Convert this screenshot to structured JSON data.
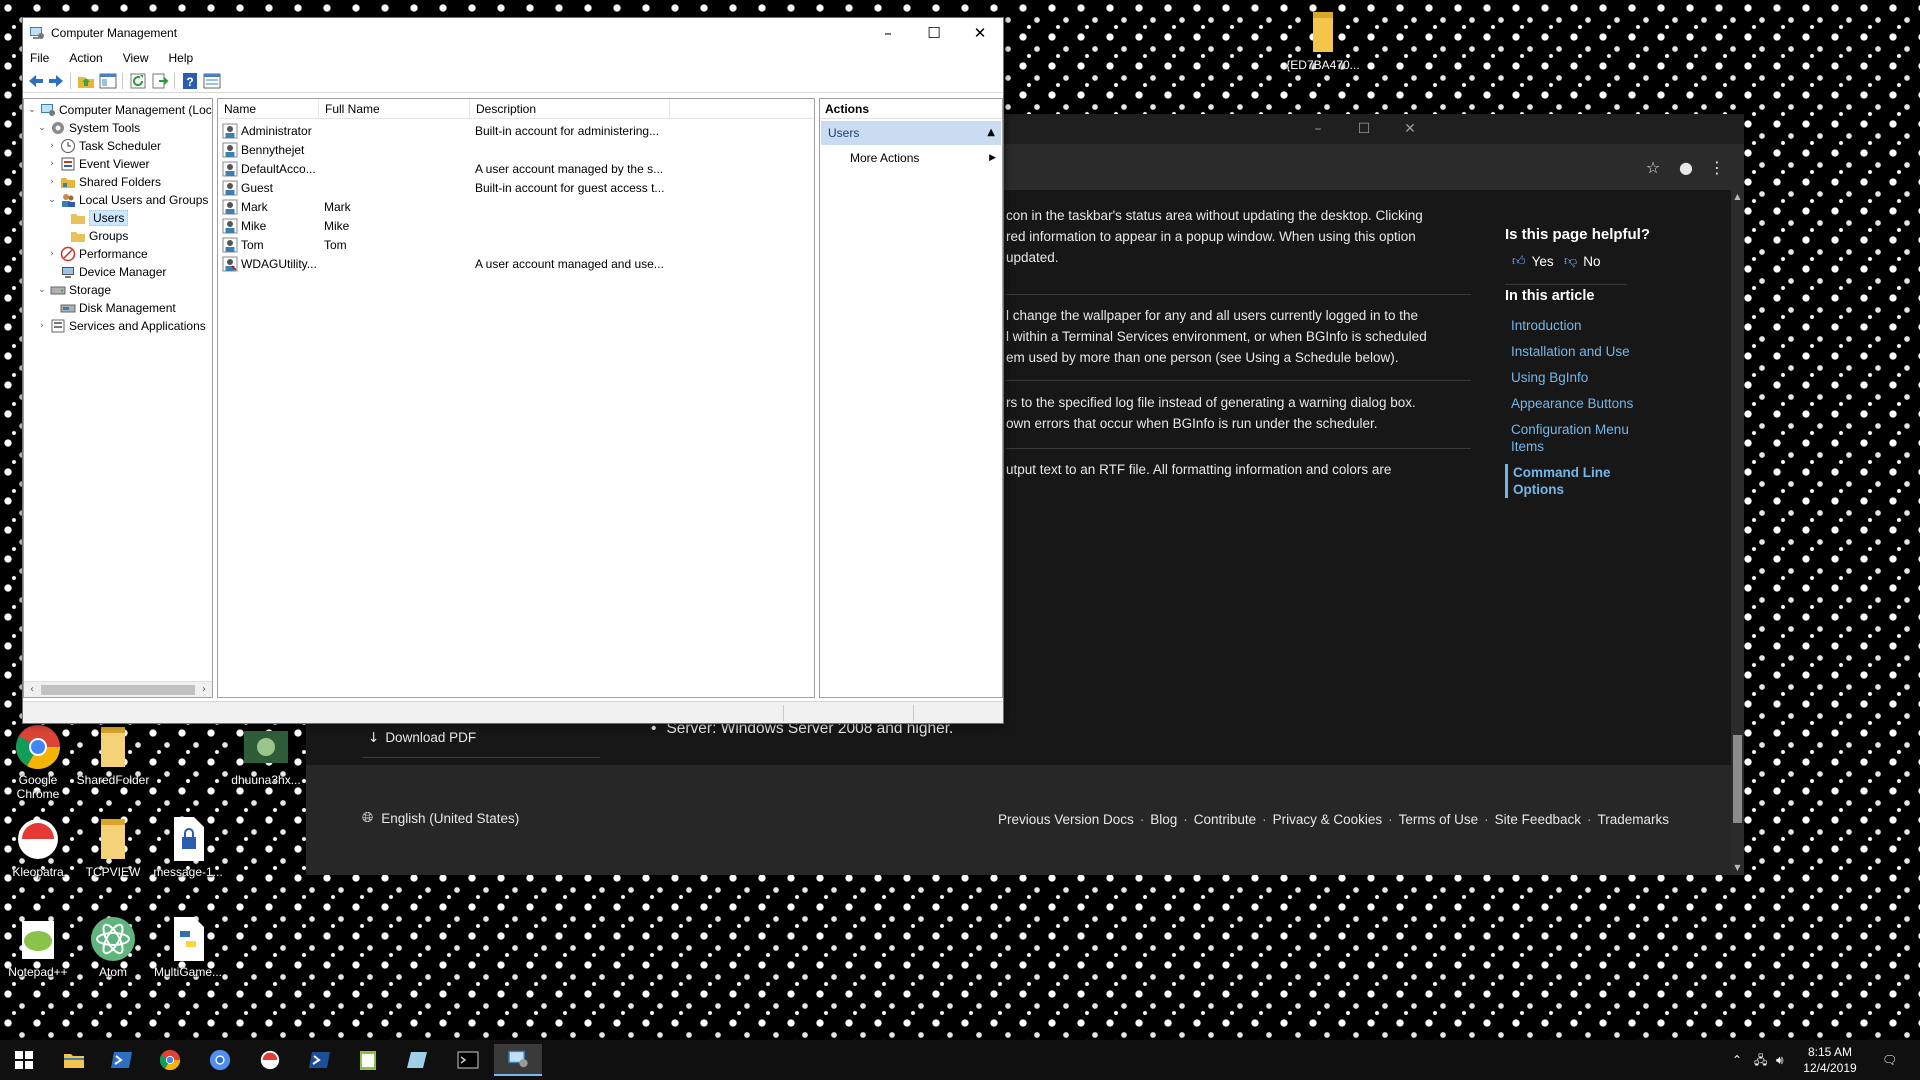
{
  "computer_management": {
    "title": "Computer Management",
    "menu": [
      "File",
      "Action",
      "View",
      "Help"
    ],
    "tree": [
      {
        "label": "Computer Management (Local",
        "depth": 0,
        "twisty": "expanded",
        "icon": "computer-management-icon"
      },
      {
        "label": "System Tools",
        "depth": 1,
        "twisty": "expanded",
        "icon": "system-tools-icon"
      },
      {
        "label": "Task Scheduler",
        "depth": 2,
        "twisty": "collapsed",
        "icon": "task-scheduler-icon"
      },
      {
        "label": "Event Viewer",
        "depth": 2,
        "twisty": "collapsed",
        "icon": "event-viewer-icon"
      },
      {
        "label": "Shared Folders",
        "depth": 2,
        "twisty": "collapsed",
        "icon": "shared-folders-icon"
      },
      {
        "label": "Local Users and Groups",
        "depth": 2,
        "twisty": "expanded",
        "icon": "local-users-icon"
      },
      {
        "label": "Users",
        "depth": 3,
        "twisty": "none",
        "icon": "folder-icon",
        "selected": true
      },
      {
        "label": "Groups",
        "depth": 3,
        "twisty": "none",
        "icon": "folder-icon"
      },
      {
        "label": "Performance",
        "depth": 2,
        "twisty": "collapsed",
        "icon": "performance-icon"
      },
      {
        "label": "Device Manager",
        "depth": 2,
        "twisty": "none",
        "icon": "device-manager-icon"
      },
      {
        "label": "Storage",
        "depth": 1,
        "twisty": "expanded",
        "icon": "storage-icon"
      },
      {
        "label": "Disk Management",
        "depth": 2,
        "twisty": "none",
        "icon": "disk-management-icon"
      },
      {
        "label": "Services and Applications",
        "depth": 1,
        "twisty": "collapsed",
        "icon": "services-icon"
      }
    ],
    "columns": [
      "Name",
      "Full Name",
      "Description"
    ],
    "users": [
      {
        "name": "Administrator",
        "full_name": "",
        "description": "Built-in account for administering..."
      },
      {
        "name": "Bennythejet",
        "full_name": "",
        "description": ""
      },
      {
        "name": "DefaultAcco...",
        "full_name": "",
        "description": "A user account managed by the s..."
      },
      {
        "name": "Guest",
        "full_name": "",
        "description": "Built-in account for guest access t..."
      },
      {
        "name": "Mark",
        "full_name": "Mark",
        "description": ""
      },
      {
        "name": "Mike",
        "full_name": "Mike",
        "description": ""
      },
      {
        "name": "Tom",
        "full_name": "Tom",
        "description": ""
      },
      {
        "name": "WDAGUtility...",
        "full_name": "",
        "description": "A user account managed and use..."
      }
    ],
    "actions": {
      "header": "Actions",
      "section": "Users",
      "more": "More Actions"
    }
  },
  "browser": {
    "paragraphs": [
      {
        "lines": [
          "con in the taskbar's status area without updating the desktop. Clicking",
          "red information to appear in a popup window. When using this option",
          "updated."
        ]
      },
      {
        "lines": [
          "l change the wallpaper for any and all users currently logged in to the",
          "l within a Terminal Services environment, or when BGInfo is scheduled",
          "em used by more than one person (see Using a Schedule below)."
        ]
      },
      {
        "lines": [
          "rs to the specified log file instead of generating a warning dialog box.",
          "own errors that occur when BGInfo is run under the scheduler."
        ]
      },
      {
        "lines": [
          "utput text to an RTF file. All formatting information and colors are"
        ]
      }
    ],
    "helpful": {
      "title": "Is this page helpful?",
      "yes": "Yes",
      "no": "No"
    },
    "in_this_article": "In this article",
    "toc": [
      "Introduction",
      "Installation and Use",
      "Using BgInfo",
      "Appearance Buttons",
      "Configuration Menu Items",
      "Command Line Options"
    ],
    "toc_active": "Command Line Options",
    "download_pdf": "Download PDF",
    "server_item": "Server: Windows Server 2008 and higher.",
    "footer": {
      "language": "English (United States)",
      "links": [
        "Previous Version Docs",
        "Blog",
        "Contribute",
        "Privacy & Cookies",
        "Terms of Use",
        "Site Feedback",
        "Trademarks"
      ]
    }
  },
  "desktop": {
    "top_folder_label": "{ED7BA470...",
    "icons": [
      {
        "label": "Google Chrome",
        "icon": "chrome-icon"
      },
      {
        "label": "SharedFolder",
        "icon": "folder-icon"
      },
      {
        "label": "dhuuna3hx...",
        "icon": "image-file-icon"
      },
      {
        "label": "Kleopatra",
        "icon": "kleopatra-icon"
      },
      {
        "label": "TCPVIEW",
        "icon": "folder-icon"
      },
      {
        "label": "message-1...",
        "icon": "encrypted-file-icon"
      },
      {
        "label": "Notepad++",
        "icon": "notepadpp-icon"
      },
      {
        "label": "Atom",
        "icon": "atom-icon"
      },
      {
        "label": "MultiGame...",
        "icon": "python-file-icon"
      }
    ]
  },
  "taskbar": {
    "time": "8:15 AM",
    "date": "12/4/2019",
    "pinned": [
      "start-icon",
      "file-explorer-icon",
      "powershell-icon",
      "chrome-icon",
      "chromium-icon",
      "kleopatra-icon",
      "powershell-ise-icon",
      "notepad-icon",
      "tablet-icon",
      "terminal-icon",
      "computer-management-icon"
    ]
  },
  "colors": {
    "accent": "#75b6e7",
    "selection": "#cce8ff",
    "actions_header": "#c9dcf2"
  }
}
